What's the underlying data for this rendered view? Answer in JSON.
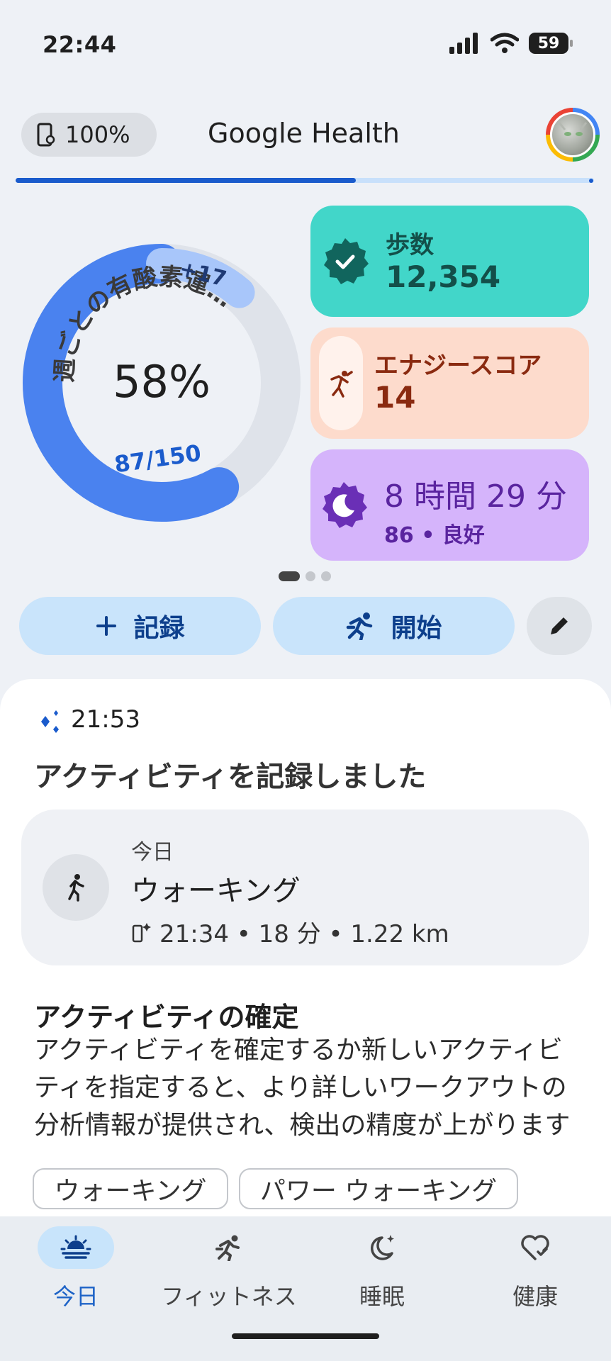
{
  "status_bar": {
    "time": "22:44",
    "battery_level": "59"
  },
  "header": {
    "battery_chip": "100%",
    "app_title": "Google Health"
  },
  "colors": {
    "accent_blue": "#1a5bcc",
    "ring_blue": "#4a82ef",
    "steps_card": "#42d6c9",
    "energy_card": "#fddbcc",
    "sleep_card": "#d5b4fb"
  },
  "ring": {
    "title": "週ごとの有酸素運…",
    "percent": "58%",
    "progress_label": "87/150",
    "bonus_label": "+17",
    "progress_fraction": 0.58,
    "bonus_fraction": 0.113
  },
  "cards": {
    "steps": {
      "label": "歩数",
      "value": "12,354"
    },
    "energy": {
      "label": "エナジースコア",
      "value": "14"
    },
    "sleep": {
      "value": "8 時間 29 分",
      "sub": "86 • 良好"
    }
  },
  "carousel": {
    "pages": 3,
    "active": 0
  },
  "actions": {
    "record": "記録",
    "start": "開始"
  },
  "insight": {
    "time": "21:53",
    "title": "アクティビティを記録しました",
    "activity": {
      "day": "今日",
      "name": "ウォーキング",
      "detail": "21:34 • 18 分 • 1.22 km"
    },
    "confirm_title": "アクティビティの確定",
    "confirm_body": "アクティビティを確定するか新しいアクティビティを指定すると、より詳しいワークアウトの分析情報が提供され、検出の精度が上がります",
    "chips": [
      "ウォーキング",
      "パワー ウォーキング"
    ]
  },
  "nav": [
    {
      "label": "今日",
      "icon": "today-icon",
      "active": true
    },
    {
      "label": "フィットネス",
      "icon": "fitness-icon",
      "active": false
    },
    {
      "label": "睡眠",
      "icon": "sleep-icon",
      "active": false
    },
    {
      "label": "健康",
      "icon": "health-icon",
      "active": false
    }
  ]
}
